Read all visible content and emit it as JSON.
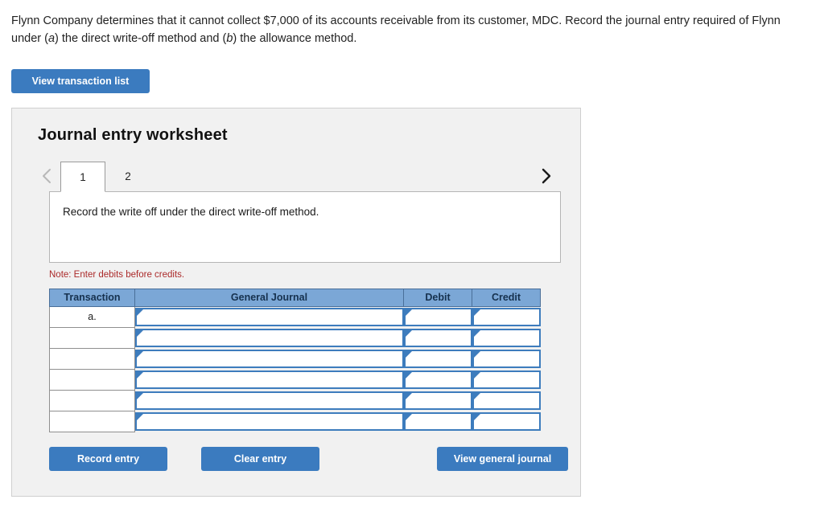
{
  "problem": {
    "text_part1": "Flynn Company determines that it cannot collect $7,000 of its accounts receivable from its customer, MDC. Record the journal entry required of Flynn under (",
    "italic_a": "a",
    "text_part2": ") the direct write-off method and (",
    "italic_b": "b",
    "text_part3": ") the allowance method."
  },
  "toolbar": {
    "view_transaction_list_label": "View transaction list"
  },
  "worksheet": {
    "title": "Journal entry worksheet",
    "tabs": [
      {
        "label": "1",
        "active": true
      },
      {
        "label": "2",
        "active": false
      }
    ],
    "nav": {
      "prev_icon": "chevron-left-icon",
      "next_icon": "chevron-right-icon",
      "prev_enabled": false,
      "next_enabled": true
    },
    "instruction": "Record the write off under the direct write-off method.",
    "note": "Note: Enter debits before credits.",
    "table": {
      "headers": [
        "Transaction",
        "General Journal",
        "Debit",
        "Credit"
      ],
      "rows": [
        {
          "transaction": "a.",
          "general_journal": "",
          "debit": "",
          "credit": ""
        },
        {
          "transaction": "",
          "general_journal": "",
          "debit": "",
          "credit": ""
        },
        {
          "transaction": "",
          "general_journal": "",
          "debit": "",
          "credit": ""
        },
        {
          "transaction": "",
          "general_journal": "",
          "debit": "",
          "credit": ""
        },
        {
          "transaction": "",
          "general_journal": "",
          "debit": "",
          "credit": ""
        },
        {
          "transaction": "",
          "general_journal": "",
          "debit": "",
          "credit": ""
        }
      ]
    },
    "buttons": {
      "record_entry": "Record entry",
      "clear_entry": "Clear entry",
      "view_general_journal": "View general journal"
    }
  },
  "colors": {
    "button_blue": "#3b7bbf",
    "header_blue": "#7ba7d6",
    "cell_border_blue": "#3d7cbd",
    "note_red": "#ab2a2a",
    "panel_gray": "#f1f1f1"
  }
}
